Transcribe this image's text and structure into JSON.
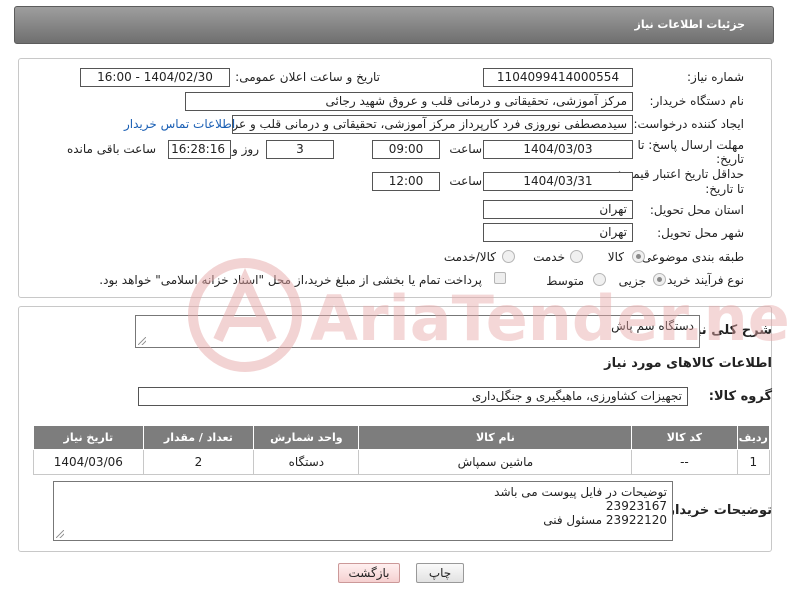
{
  "header": {
    "title": "جزئیات اطلاعات نیاز"
  },
  "form": {
    "need_number_label": "شماره نیاز:",
    "need_number": "1104099414000554",
    "announce_label": "تاریخ و ساعت اعلان عمومی:",
    "announce_value": "1404/02/30 - 16:00",
    "buyer_label": "نام دستگاه خریدار:",
    "buyer_value": "مرکز آموزشی، تحقیقاتی و درمانی قلب و عروق شهید رجائی",
    "creator_label": "ایجاد کننده درخواست:",
    "creator_value": "سیدمصطفی نوروزی فرد کارپرداز مرکز آموزشی، تحقیقاتی و درمانی قلب و عروق",
    "contact_link": "اطلاعات تماس خریدار",
    "deadline_label_1": "مهلت ارسال پاسخ: تا",
    "deadline_label_2": "تاریخ:",
    "deadline_date": "1404/03/03",
    "time_label": "ساعت",
    "deadline_time": "09:00",
    "days_value": "3",
    "days_label": "روز و",
    "remaining_time": "16:28:16",
    "remaining_label": "ساعت باقی مانده",
    "validity_label_1": "حداقل تاریخ اعتبار قیمت:",
    "validity_label_2": "تا تاریخ:",
    "validity_date": "1404/03/31",
    "validity_time": "12:00",
    "province_label": "استان محل تحویل:",
    "province_value": "تهران",
    "city_label": "شهر محل تحویل:",
    "city_value": "تهران",
    "category_label": "طبقه بندی موضوعی:",
    "category_options": [
      "کالا",
      "خدمت",
      "کالا/خدمت"
    ],
    "process_label": "نوع فرآیند خرید :",
    "process_options": [
      "جزیی",
      "متوسط"
    ],
    "payment_note": "پرداخت تمام یا بخشی از مبلغ خرید،از محل \"اسناد خزانه اسلامی\" خواهد بود."
  },
  "description": {
    "label": "شرح کلی نیاز:",
    "value": "دستگاه سم پاش",
    "items_heading": "اطلاعات کالاهای مورد نیاز",
    "group_label": "گروه کالا:",
    "group_value": "تجهیزات کشاورزی، ماهیگیری و جنگل‌داری"
  },
  "table": {
    "headers": [
      "ردیف",
      "کد کالا",
      "نام کالا",
      "واحد شمارش",
      "تعداد / مقدار",
      "تاریخ نیاز"
    ],
    "rows": [
      [
        "1",
        "--",
        "ماشین سمپاش",
        "دستگاه",
        "2",
        "1404/03/06"
      ]
    ]
  },
  "buyer_notes": {
    "label": "توضیحات خریدار:",
    "lines": [
      "توضیحات در فایل پیوست می باشد",
      "23923167",
      "23922120 مسئول فنی"
    ]
  },
  "buttons": {
    "print": "چاپ",
    "back": "بازگشت"
  },
  "watermark": {
    "text": "AriaTender.neT"
  },
  "colors": {
    "header": "#7d7d7d",
    "link": "#1a5fb4",
    "watermark": "#e7a8a8"
  }
}
